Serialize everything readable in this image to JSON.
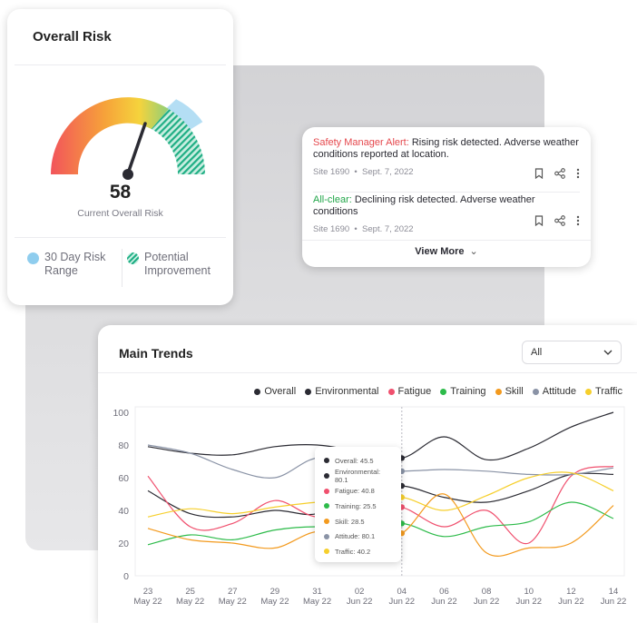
{
  "risk_card": {
    "title": "Overall Risk",
    "value": "58",
    "value_label": "Current Overall Risk",
    "legend_range": "30 Day Risk Range",
    "legend_improvement": "Potential Improvement",
    "gauge_value": 58
  },
  "alerts": {
    "items": [
      {
        "tag": "Safety Manager Alert:",
        "tag_color": "#e5484d",
        "message": " Rising risk detected. Adverse weather conditions reported at location.",
        "site": "Site 1690",
        "date": "Sept. 7, 2022"
      },
      {
        "tag": "All-clear:",
        "tag_color": "#22a64a",
        "message": " Declining risk detected. Adverse weather conditions",
        "site": "Site 1690",
        "date": "Sept. 7, 2022"
      }
    ],
    "view_more": "View More"
  },
  "trends": {
    "title": "Main Trends",
    "filter_value": "All",
    "tooltip": [
      {
        "label": "Overall: 45.5",
        "color": "#2b2b33"
      },
      {
        "label": "Environmental: 80.1",
        "color": "#2b2b33"
      },
      {
        "label": "Fatigue: 40.8",
        "color": "#f0506e"
      },
      {
        "label": "Training: 25.5",
        "color": "#2dbb4a"
      },
      {
        "label": "Skill: 28.5",
        "color": "#f39a1e"
      },
      {
        "label": "Attitude: 80.1",
        "color": "#8a93a6"
      },
      {
        "label": "Traffic: 40.2",
        "color": "#f6cf2c"
      }
    ]
  },
  "chart_data": {
    "type": "line",
    "x": [
      "23\nMay 22",
      "25\nMay 22",
      "27\nMay 22",
      "29\nMay 22",
      "31\nMay 22",
      "02\nJun 22",
      "04\nJun 22",
      "06\nJun 22",
      "08\nJun 22",
      "10\nJun 22",
      "12\nJun 22",
      "14\nJun 22"
    ],
    "ylim": [
      0,
      100
    ],
    "yticks": [
      0,
      20,
      40,
      60,
      80,
      100
    ],
    "grid": false,
    "legend_position": "top-right",
    "series": [
      {
        "name": "Overall",
        "color": "#2b2b33",
        "values": [
          52,
          38,
          36,
          40,
          38,
          52,
          55,
          48,
          45,
          52,
          62,
          62
        ]
      },
      {
        "name": "Environmental",
        "color": "#2b2b33",
        "values": [
          79,
          75,
          74,
          79,
          80,
          76,
          72,
          85,
          71,
          78,
          91,
          100
        ]
      },
      {
        "name": "Fatigue",
        "color": "#f0506e",
        "values": [
          61,
          30,
          32,
          46,
          36,
          44,
          42,
          30,
          40,
          20,
          61,
          67
        ]
      },
      {
        "name": "Training",
        "color": "#2dbb4a",
        "values": [
          19,
          25,
          22,
          28,
          30,
          28,
          32,
          24,
          30,
          33,
          45,
          35
        ]
      },
      {
        "name": "Skill",
        "color": "#f39a1e",
        "values": [
          29,
          22,
          20,
          17,
          27,
          22,
          26,
          50,
          14,
          17,
          20,
          43
        ]
      },
      {
        "name": "Attitude",
        "color": "#8a93a6",
        "values": [
          80,
          75,
          65,
          60,
          72,
          65,
          64,
          65,
          64,
          62,
          62,
          66
        ]
      },
      {
        "name": "Traffic",
        "color": "#f6cf2c",
        "values": [
          36,
          41,
          38,
          42,
          45,
          46,
          48,
          40,
          49,
          60,
          63,
          52
        ]
      }
    ]
  }
}
